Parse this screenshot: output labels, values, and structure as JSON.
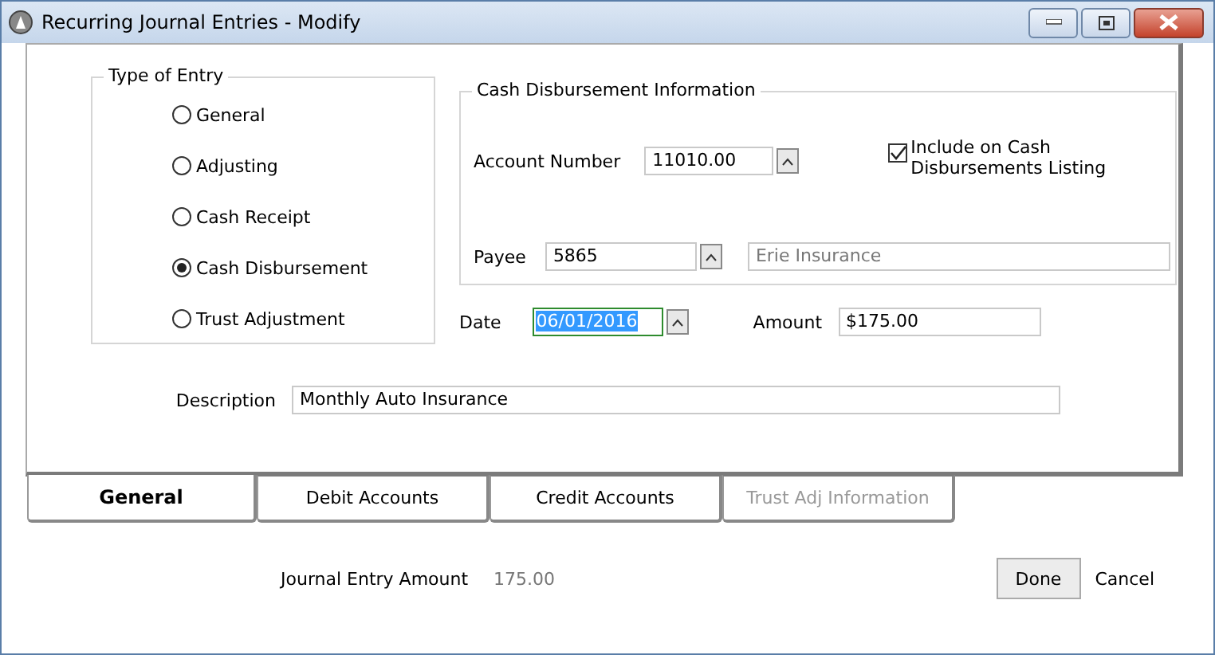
{
  "window": {
    "title": "Recurring Journal Entries - Modify"
  },
  "entry_type": {
    "legend": "Type of Entry",
    "options": [
      {
        "label": "General",
        "selected": false
      },
      {
        "label": "Adjusting",
        "selected": false
      },
      {
        "label": "Cash Receipt",
        "selected": false
      },
      {
        "label": "Cash Disbursement",
        "selected": true
      },
      {
        "label": "Trust Adjustment",
        "selected": false
      }
    ]
  },
  "cash_disbursement": {
    "legend": "Cash Disbursement Information",
    "account_number_label": "Account Number",
    "account_number": "11010.00",
    "include_listing": {
      "label": "Include on Cash Disbursements Listing",
      "checked": true
    },
    "payee_label": "Payee",
    "payee": "5865",
    "payee_name": "Erie Insurance"
  },
  "date": {
    "label": "Date",
    "value": "06/01/2016",
    "focused": true
  },
  "amount": {
    "label": "Amount",
    "value": "$175.00"
  },
  "description": {
    "label": "Description",
    "value": "Monthly Auto Insurance"
  },
  "tabs": [
    {
      "label": "General",
      "selected": true,
      "disabled": false
    },
    {
      "label": "Debit Accounts",
      "selected": false,
      "disabled": false
    },
    {
      "label": "Credit Accounts",
      "selected": false,
      "disabled": false
    },
    {
      "label": "Trust Adj Information",
      "selected": false,
      "disabled": true
    }
  ],
  "journal_entry_amount": {
    "label": "Journal Entry Amount",
    "value": "175.00"
  },
  "buttons": {
    "done": "Done",
    "cancel": "Cancel"
  }
}
